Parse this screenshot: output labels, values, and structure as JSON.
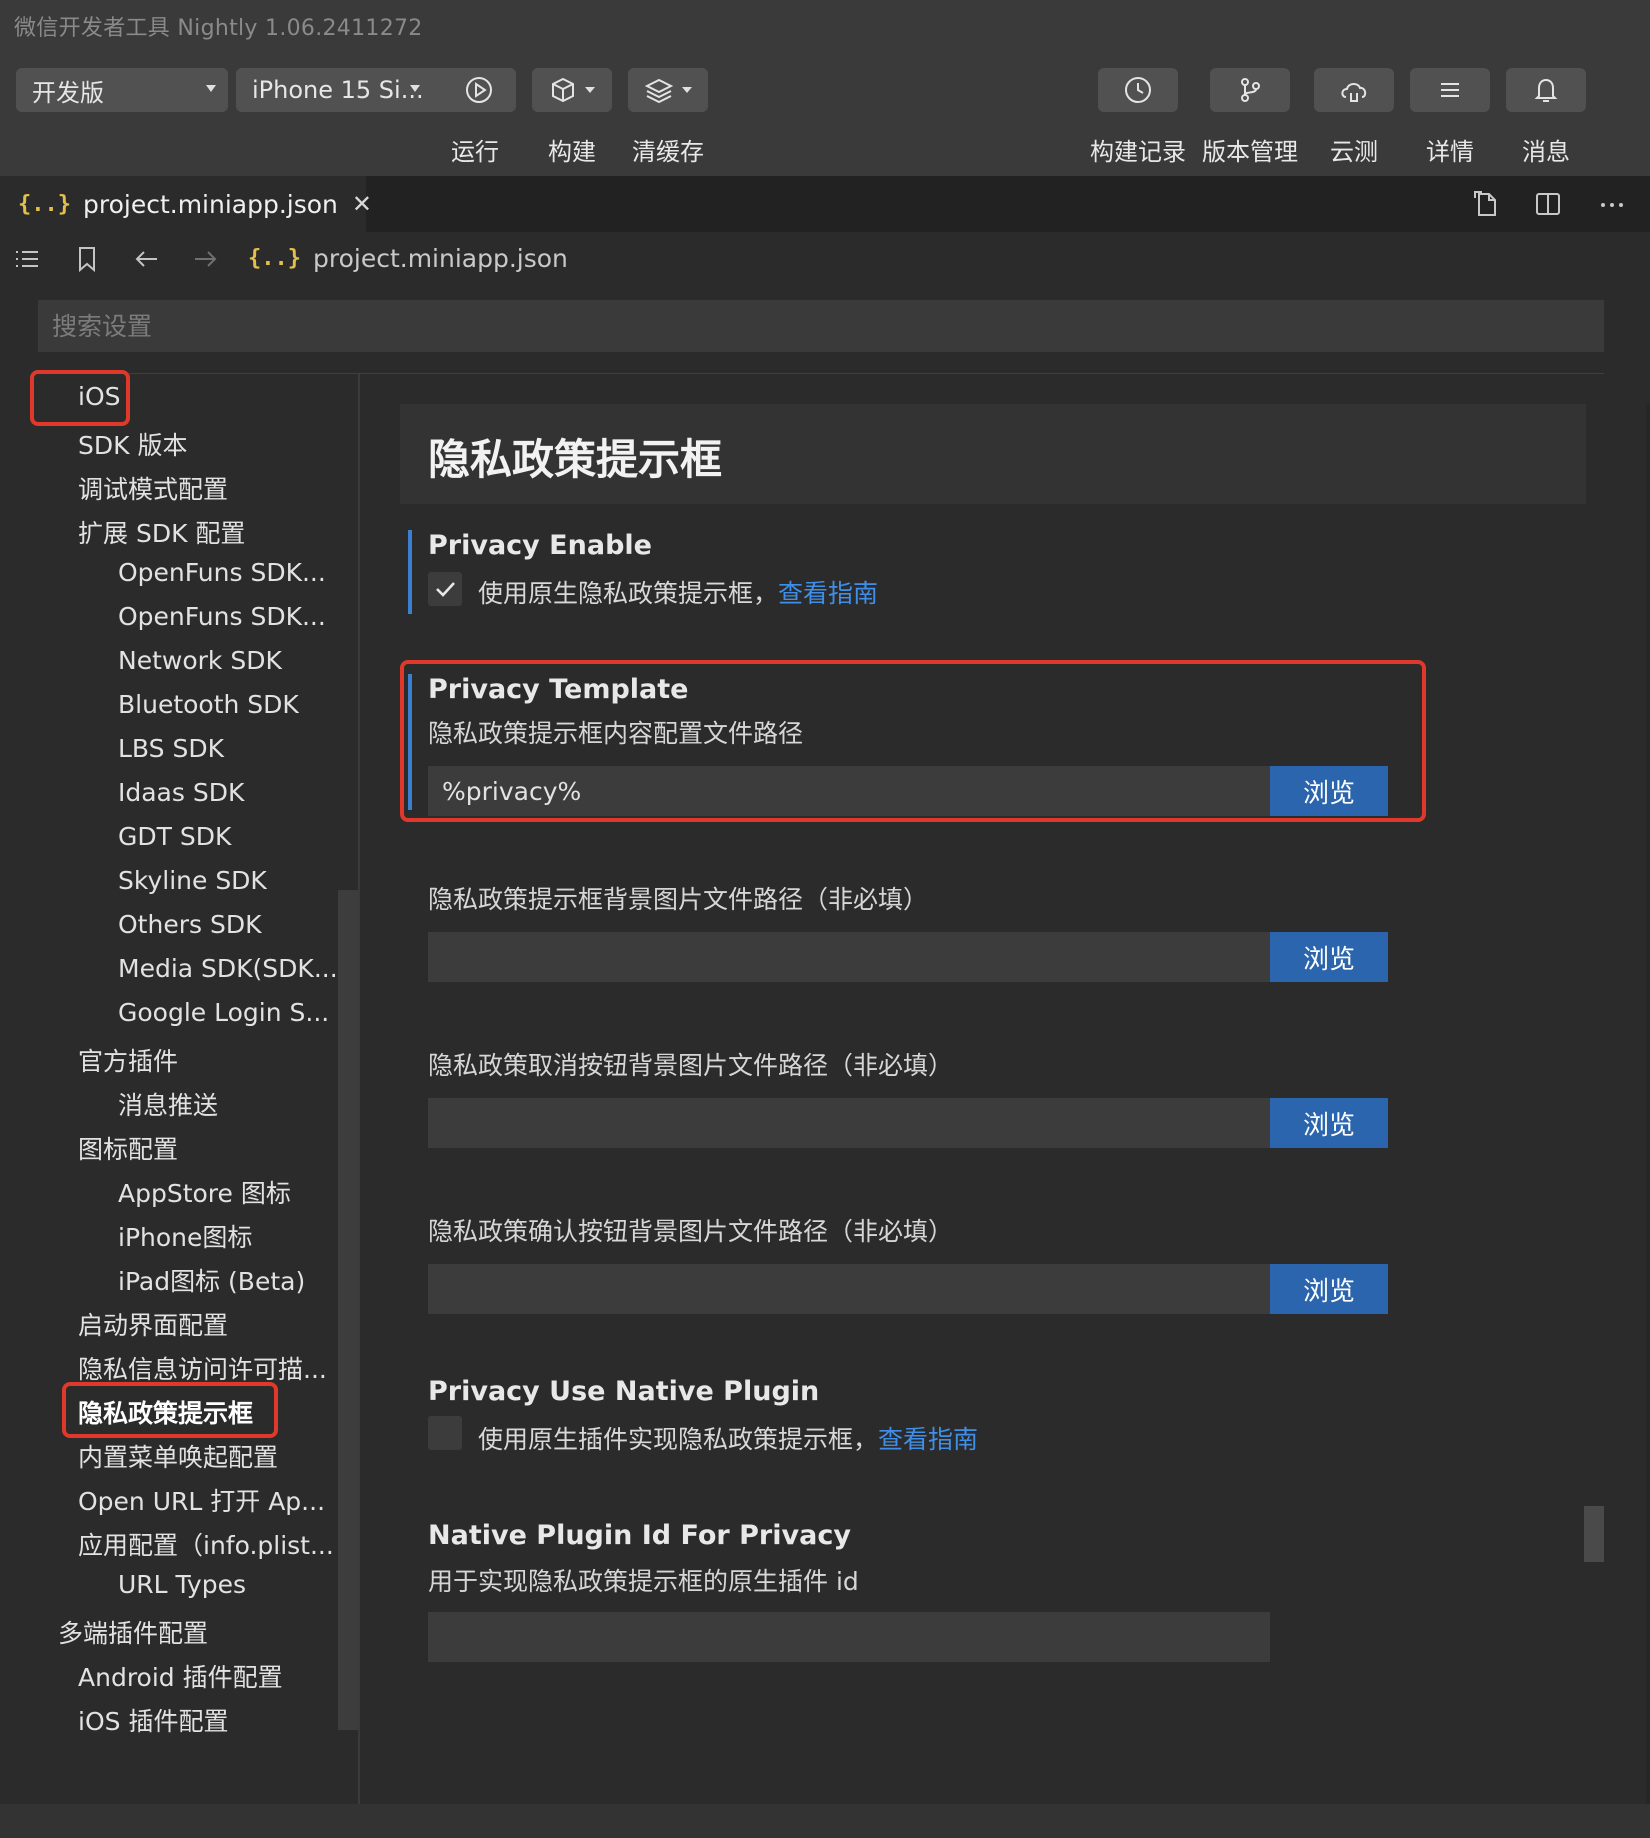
{
  "window": {
    "title": "微信开发者工具 Nightly 1.06.2411272"
  },
  "toolbar": {
    "mode_select": "开发版",
    "device_select": "iPhone 15 Si...",
    "run_label": "运行",
    "build_label": "构建",
    "clear_cache_label": "清缓存",
    "build_history_label": "构建记录",
    "version_mgmt_label": "版本管理",
    "cloud_test_label": "云测",
    "details_label": "详情",
    "messages_label": "消息"
  },
  "editor": {
    "tab_label": "project.miniapp.json",
    "breadcrumb_file": "project.miniapp.json"
  },
  "search": {
    "placeholder": "搜索设置"
  },
  "sidebar": {
    "items": [
      {
        "label": "iOS",
        "level": 1
      },
      {
        "label": "SDK 版本",
        "level": 1
      },
      {
        "label": "调试模式配置",
        "level": 1
      },
      {
        "label": "扩展 SDK 配置",
        "level": 1
      },
      {
        "label": "OpenFuns SDK...",
        "level": 2
      },
      {
        "label": "OpenFuns SDK...",
        "level": 2
      },
      {
        "label": "Network SDK",
        "level": 2
      },
      {
        "label": "Bluetooth SDK",
        "level": 2
      },
      {
        "label": "LBS SDK",
        "level": 2
      },
      {
        "label": "Idaas SDK",
        "level": 2
      },
      {
        "label": "GDT SDK",
        "level": 2
      },
      {
        "label": "Skyline SDK",
        "level": 2
      },
      {
        "label": "Others SDK",
        "level": 2
      },
      {
        "label": "Media SDK(SDK...",
        "level": 2
      },
      {
        "label": "Google Login S...",
        "level": 2
      },
      {
        "label": "官方插件",
        "level": 1
      },
      {
        "label": "消息推送",
        "level": 2
      },
      {
        "label": "图标配置",
        "level": 1
      },
      {
        "label": "AppStore 图标",
        "level": 2
      },
      {
        "label": "iPhone图标",
        "level": 2
      },
      {
        "label": "iPad图标 (Beta)",
        "level": 2
      },
      {
        "label": "启动界面配置",
        "level": 1
      },
      {
        "label": "隐私信息访问许可描...",
        "level": 1
      },
      {
        "label": "隐私政策提示框",
        "level": 1,
        "active": true
      },
      {
        "label": "内置菜单唤起配置",
        "level": 1
      },
      {
        "label": "Open URL 打开 Ap...",
        "level": 1
      },
      {
        "label": "应用配置（info.plist...",
        "level": 1
      },
      {
        "label": "URL Types",
        "level": 2
      },
      {
        "label": "多端插件配置",
        "level": 0
      },
      {
        "label": "Android 插件配置",
        "level": 1
      },
      {
        "label": "iOS 插件配置",
        "level": 1
      }
    ]
  },
  "main": {
    "page_title": "隐私政策提示框",
    "privacy_enable": {
      "title": "Privacy Enable",
      "checked": true,
      "label": "使用原生隐私政策提示框，",
      "link": "查看指南"
    },
    "privacy_template": {
      "title": "Privacy Template",
      "desc": "隐私政策提示框内容配置文件路径",
      "value": "%privacy%",
      "button": "浏览"
    },
    "bg_image": {
      "desc": "隐私政策提示框背景图片文件路径（非必填）",
      "value": "",
      "button": "浏览"
    },
    "cancel_bg": {
      "desc": "隐私政策取消按钮背景图片文件路径（非必填）",
      "value": "",
      "button": "浏览"
    },
    "confirm_bg": {
      "desc": "隐私政策确认按钮背景图片文件路径（非必填）",
      "value": "",
      "button": "浏览"
    },
    "use_native_plugin": {
      "title": "Privacy Use Native Plugin",
      "checked": false,
      "label": "使用原生插件实现隐私政策提示框，",
      "link": "查看指南"
    },
    "native_plugin_id": {
      "title": "Native Plugin Id For Privacy",
      "desc": "用于实现隐私政策提示框的原生插件 id",
      "value": ""
    }
  },
  "colors": {
    "background": "#2b2b2b",
    "toolbar": "#3a3a3a",
    "button": "#515151",
    "accent_blue": "#2a65ad",
    "link_blue": "#3f8fe8",
    "highlight_red": "#e0392b",
    "json_icon": "#e2c04a"
  },
  "icons": {
    "run": "play-circle-icon",
    "build": "cube-icon",
    "clear_cache": "layers-icon",
    "build_history": "clock-icon",
    "version_mgmt": "git-branch-icon",
    "cloud_test": "cloud-test-icon",
    "details": "menu-icon",
    "messages": "bell-icon"
  }
}
